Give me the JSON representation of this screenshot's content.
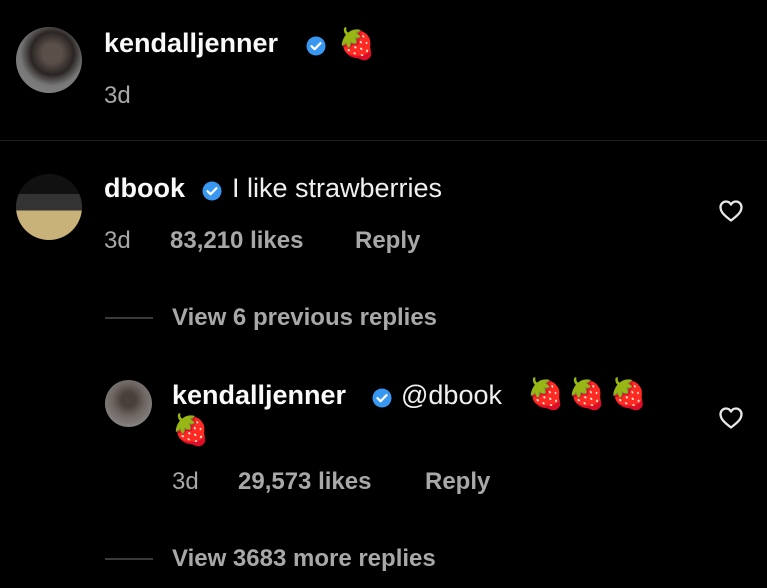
{
  "top_post": {
    "username": "kendalljenner",
    "emoji": "🍓",
    "time": "3d"
  },
  "comment": {
    "username": "dbook",
    "text": "I like strawberries",
    "time": "3d",
    "likes": "83,210 likes",
    "reply_label": "Reply"
  },
  "view_previous": "View 6 previous replies",
  "reply": {
    "username": "kendalljenner",
    "mention": "@dbook",
    "emojis_line1": "🍓🍓🍓",
    "emojis_line2": "🍓",
    "time": "3d",
    "likes": "29,573 likes",
    "reply_label": "Reply"
  },
  "view_more": "View 3683 more replies",
  "colors": {
    "background": "#000000",
    "verified": "#3897f0",
    "muted": "#a8a8a8"
  },
  "icons": {
    "verified": "verified-badge-icon",
    "like": "heart-outline-icon"
  }
}
